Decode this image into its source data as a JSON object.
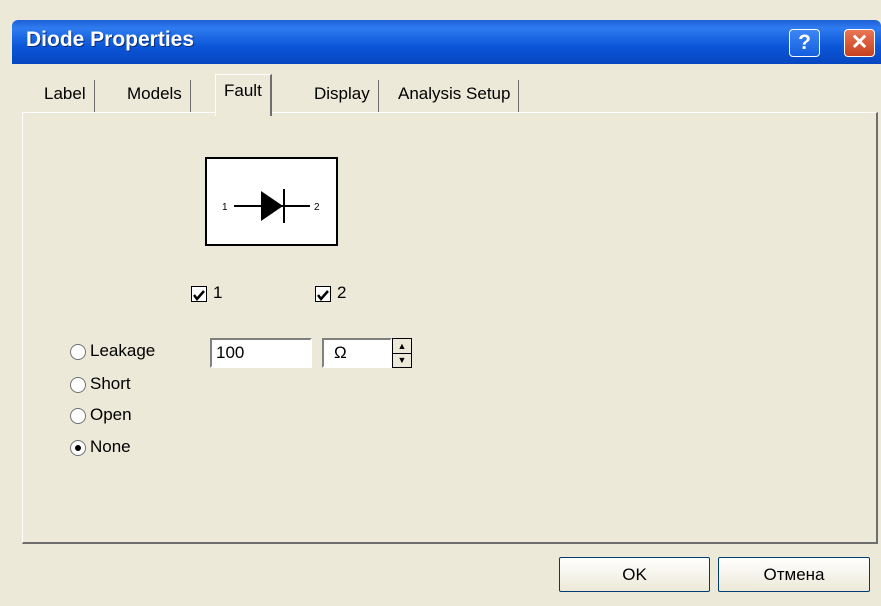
{
  "window": {
    "title": "Diode Properties",
    "help_label": "?",
    "close_label": "✕"
  },
  "tabs": [
    {
      "label": "Label",
      "active": false
    },
    {
      "label": "Models",
      "active": false
    },
    {
      "label": "Fault",
      "active": true
    },
    {
      "label": "Display",
      "active": false
    },
    {
      "label": "Analysis Setup",
      "active": false
    }
  ],
  "diode": {
    "pin1_label": "1",
    "pin2_label": "2"
  },
  "checkboxes": [
    {
      "label": "1",
      "checked": true
    },
    {
      "label": "2",
      "checked": true
    }
  ],
  "fault_options": [
    {
      "label": "Leakage",
      "selected": false
    },
    {
      "label": "Short",
      "selected": false
    },
    {
      "label": "Open",
      "selected": false
    },
    {
      "label": "None",
      "selected": true
    }
  ],
  "leakage": {
    "value": "100",
    "unit": "Ω"
  },
  "buttons": {
    "ok_label": "OK",
    "cancel_label": "Отмена"
  }
}
